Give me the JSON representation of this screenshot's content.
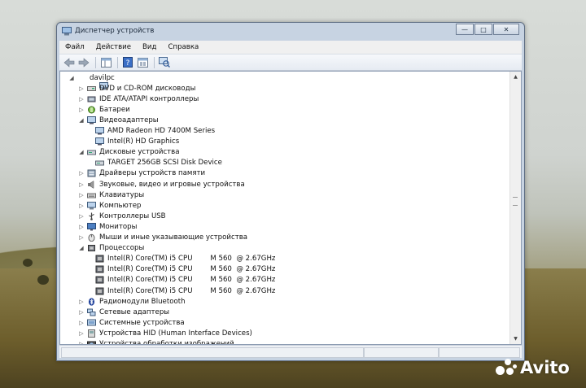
{
  "window": {
    "title": "Диспетчер устройств",
    "controls": {
      "minimize": "—",
      "maximize": "□",
      "close": "✕"
    }
  },
  "menu": [
    "Файл",
    "Действие",
    "Вид",
    "Справка"
  ],
  "toolbar": {
    "icons": [
      "back-arrow-icon",
      "forward-arrow-icon",
      "console-tree-icon",
      "help-icon",
      "properties-icon",
      "scan-hardware-icon"
    ]
  },
  "tree": {
    "root": "davilpc",
    "items": [
      {
        "label": "DVD и CD-ROM дисководы",
        "icon": "dvd-drive-icon",
        "expanded": false
      },
      {
        "label": "IDE ATA/ATAPI контроллеры",
        "icon": "ide-controller-icon",
        "expanded": false
      },
      {
        "label": "Батареи",
        "icon": "battery-icon",
        "expanded": false
      },
      {
        "label": "Видеоадаптеры",
        "icon": "display-adapter-icon",
        "expanded": true,
        "children": [
          "AMD Radeon HD 7400M Series",
          "Intel(R) HD Graphics"
        ]
      },
      {
        "label": "Дисковые устройства",
        "icon": "disk-drive-icon",
        "expanded": true,
        "children": [
          "TARGET 256GB SCSI Disk Device"
        ]
      },
      {
        "label": "Драйверы устройств памяти",
        "icon": "storage-driver-icon",
        "expanded": false
      },
      {
        "label": "Звуковые, видео и игровые устройства",
        "icon": "sound-icon",
        "expanded": false
      },
      {
        "label": "Клавиатуры",
        "icon": "keyboard-icon",
        "expanded": false
      },
      {
        "label": "Компьютер",
        "icon": "computer-icon",
        "expanded": false
      },
      {
        "label": "Контроллеры USB",
        "icon": "usb-icon",
        "expanded": false
      },
      {
        "label": "Мониторы",
        "icon": "monitor-icon",
        "expanded": false
      },
      {
        "label": "Мыши и иные указывающие устройства",
        "icon": "mouse-icon",
        "expanded": false
      },
      {
        "label": "Процессоры",
        "icon": "processor-icon",
        "expanded": true,
        "children": [
          "Intel(R) Core(TM) i5 CPU        M 560  @ 2.67GHz",
          "Intel(R) Core(TM) i5 CPU        M 560  @ 2.67GHz",
          "Intel(R) Core(TM) i5 CPU        M 560  @ 2.67GHz",
          "Intel(R) Core(TM) i5 CPU        M 560  @ 2.67GHz"
        ]
      },
      {
        "label": "Радиомодули Bluetooth",
        "icon": "bluetooth-icon",
        "expanded": false
      },
      {
        "label": "Сетевые адаптеры",
        "icon": "network-adapter-icon",
        "expanded": false
      },
      {
        "label": "Системные устройства",
        "icon": "system-devices-icon",
        "expanded": false
      },
      {
        "label": "Устройства HID (Human Interface Devices)",
        "icon": "hid-icon",
        "expanded": false
      },
      {
        "label": "Устройства обработки изображений",
        "icon": "imaging-device-icon",
        "expanded": false
      }
    ]
  },
  "watermark": {
    "text": "Avito"
  }
}
